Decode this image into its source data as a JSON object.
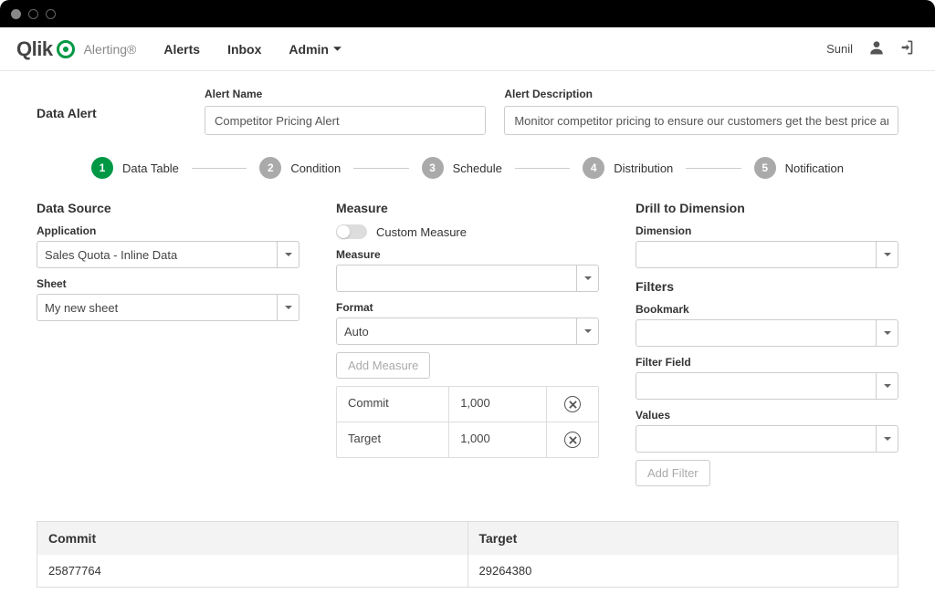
{
  "brand": {
    "name": "Qlik",
    "product": "Alerting®"
  },
  "nav": {
    "alerts": "Alerts",
    "inbox": "Inbox",
    "admin": "Admin"
  },
  "user": {
    "name": "Sunil"
  },
  "page": {
    "type_label": "Data Alert",
    "name_label": "Alert Name",
    "name_value": "Competitor Pricing Alert",
    "desc_label": "Alert Description",
    "desc_value": "Monitor competitor pricing to ensure our customers get the best price and continue to stay wi"
  },
  "steps": [
    {
      "num": "1",
      "label": "Data Table"
    },
    {
      "num": "2",
      "label": "Condition"
    },
    {
      "num": "3",
      "label": "Schedule"
    },
    {
      "num": "4",
      "label": "Distribution"
    },
    {
      "num": "5",
      "label": "Notification"
    }
  ],
  "datasource": {
    "title": "Data Source",
    "application_label": "Application",
    "application_value": "Sales Quota - Inline Data",
    "sheet_label": "Sheet",
    "sheet_value": "My new sheet"
  },
  "measure": {
    "title": "Measure",
    "custom_label": "Custom Measure",
    "measure_label": "Measure",
    "measure_value": "",
    "format_label": "Format",
    "format_value": "Auto",
    "add_button": "Add Measure",
    "rows": [
      {
        "name": "Commit",
        "value": "1,000"
      },
      {
        "name": "Target",
        "value": "1,000"
      }
    ]
  },
  "drill": {
    "title": "Drill to Dimension",
    "dimension_label": "Dimension",
    "dimension_value": "",
    "filters_title": "Filters",
    "bookmark_label": "Bookmark",
    "bookmark_value": "",
    "filterfield_label": "Filter Field",
    "filterfield_value": "",
    "values_label": "Values",
    "values_value": "",
    "add_filter": "Add Filter"
  },
  "preview": {
    "headers": [
      "Commit",
      "Target"
    ],
    "row": [
      "25877764",
      "29264380"
    ]
  }
}
